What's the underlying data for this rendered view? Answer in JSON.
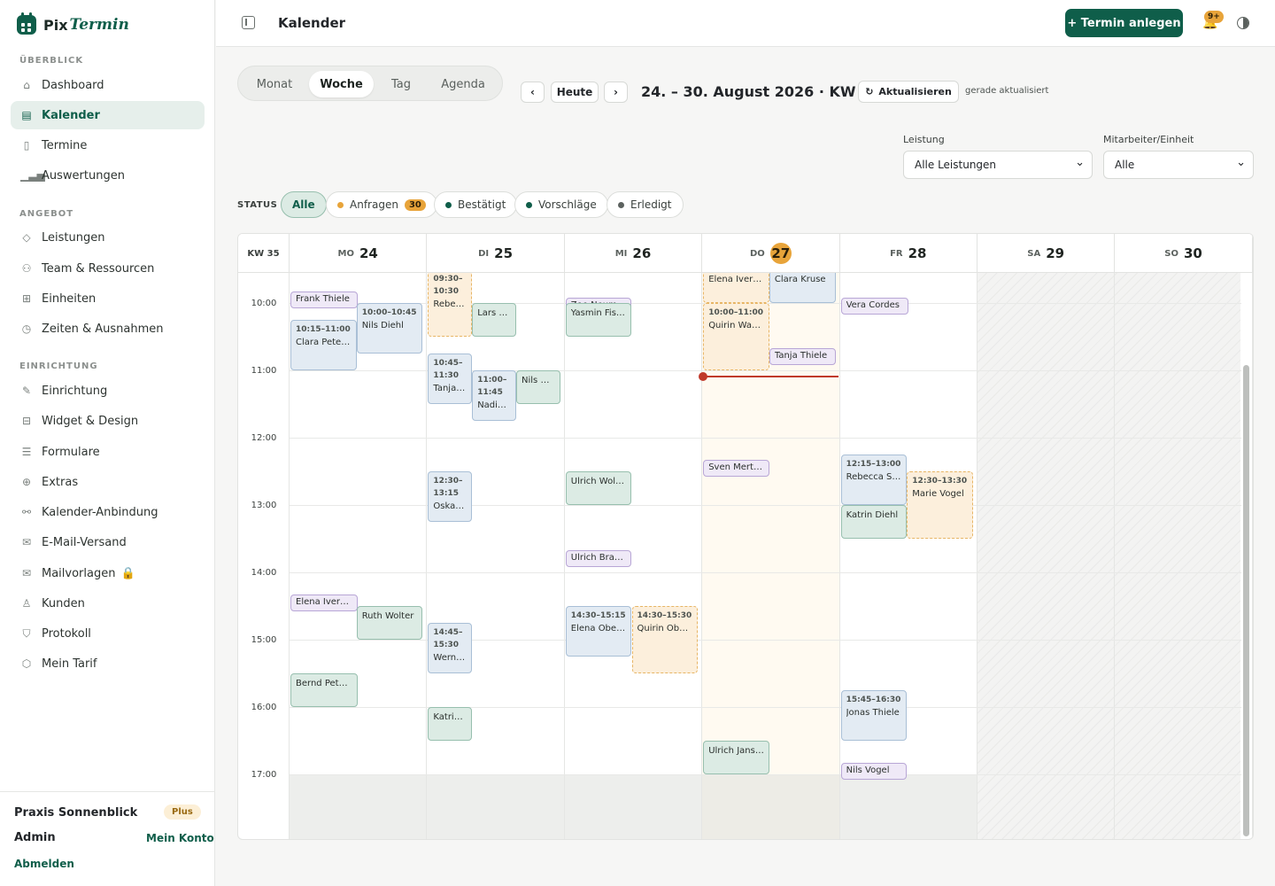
{
  "brand": {
    "name_a": "Pix",
    "name_b": "Termin"
  },
  "sidebar": {
    "sections": [
      "ÜBERBLICK",
      "ANGEBOT",
      "EINRICHTUNG"
    ],
    "items": [
      "Dashboard",
      "Kalender",
      "Termine",
      "Auswertungen",
      "Leistungen",
      "Team & Ressourcen",
      "Einheiten",
      "Zeiten & Ausnahmen",
      "Einrichtung",
      "Widget & Design",
      "Formulare",
      "Extras",
      "Kalender-Anbindung",
      "E-Mail-Versand",
      "Mailvorlagen",
      "Kunden",
      "Protokoll",
      "Mein Tarif"
    ],
    "footer": {
      "practice": "Praxis Sonnenblick",
      "plan": "Plus",
      "role": "Admin",
      "account": "Mein Konto",
      "logout": "Abmelden"
    }
  },
  "topbar": {
    "title": "Kalender",
    "new_button": "+ Termin anlegen",
    "notif_badge": "9+"
  },
  "toolbar": {
    "views": [
      "Monat",
      "Woche",
      "Tag",
      "Agenda"
    ],
    "active_view": "Woche",
    "prev": "‹",
    "today": "Heute",
    "next": "›",
    "range": "24. – 30. August 2026 · KW 35",
    "refresh": "Aktualisieren",
    "refresh_status": "gerade aktualisiert"
  },
  "filters": {
    "service_label": "Leistung",
    "service_value": "Alle Leistungen",
    "staff_label": "Mitarbeiter/Einheit",
    "staff_value": "Alle"
  },
  "status": {
    "label": "STATUS",
    "all": "Alle",
    "requests": "Anfragen",
    "requests_count": "30",
    "confirmed": "Bestätigt",
    "proposals": "Vorschläge",
    "done": "Erledigt",
    "colors": {
      "requests": "#e8a43a",
      "confirmed": "#0f5e4a",
      "proposals": "#0f5e4a",
      "done": "#5c625f"
    }
  },
  "calendar": {
    "kw": "KW 35",
    "days": [
      {
        "n": "MO",
        "d": "24"
      },
      {
        "n": "DI",
        "d": "25"
      },
      {
        "n": "MI",
        "d": "26"
      },
      {
        "n": "DO",
        "d": "27"
      },
      {
        "n": "FR",
        "d": "28"
      },
      {
        "n": "SA",
        "d": "29"
      },
      {
        "n": "SO",
        "d": "30"
      }
    ],
    "today_index": 3,
    "times": [
      "10:00",
      "11:00",
      "12:00",
      "13:00",
      "14:00",
      "15:00",
      "16:00",
      "17:00"
    ],
    "events": [
      {
        "day": 0,
        "col": 0,
        "cols": 1,
        "start": "09:50",
        "end": "10:05",
        "time": "",
        "name": "Frank Thiele",
        "color": "purple"
      },
      {
        "day": 0,
        "col": 0,
        "cols": 2,
        "start": "10:15",
        "end": "11:00",
        "time": "10:15–11:00",
        "name": "Clara Peter…",
        "color": "blue"
      },
      {
        "day": 0,
        "col": 1,
        "cols": 2,
        "start": "10:00",
        "end": "10:45",
        "time": "10:00–10:45",
        "name": "Nils Diehl",
        "color": "blue"
      },
      {
        "day": 0,
        "col": 0,
        "cols": 1,
        "start": "14:20",
        "end": "14:35",
        "time": "",
        "name": "Elena Ivers…",
        "color": "purple"
      },
      {
        "day": 0,
        "col": 1,
        "cols": 2,
        "start": "14:30",
        "end": "15:00",
        "time": "",
        "name": "Ruth Wolter",
        "color": "green"
      },
      {
        "day": 0,
        "col": 0,
        "cols": 1,
        "start": "15:30",
        "end": "16:00",
        "time": "",
        "name": "Bernd Peter…",
        "color": "green"
      },
      {
        "day": 1,
        "col": 0,
        "cols": 3,
        "start": "09:30",
        "end": "10:30",
        "time": "09:30–10:30",
        "name": "Rebec…",
        "color": "orange"
      },
      {
        "day": 1,
        "col": 1,
        "cols": 3,
        "start": "10:00",
        "end": "10:30",
        "time": "",
        "name": "Lars …",
        "color": "green"
      },
      {
        "day": 1,
        "col": 0,
        "cols": 3,
        "start": "10:45",
        "end": "11:30",
        "time": "10:45–11:30",
        "name": "Tanja …",
        "color": "blue"
      },
      {
        "day": 1,
        "col": 1,
        "cols": 3,
        "start": "11:00",
        "end": "11:45",
        "time": "11:00–11:45",
        "name": "Nadin…",
        "color": "blue"
      },
      {
        "day": 1,
        "col": 2,
        "cols": 3,
        "start": "11:00",
        "end": "11:30",
        "time": "",
        "name": "Nils C…",
        "color": "green"
      },
      {
        "day": 1,
        "col": 0,
        "cols": 3,
        "start": "12:30",
        "end": "13:15",
        "time": "12:30–13:15",
        "name": "Oskar …",
        "color": "blue"
      },
      {
        "day": 1,
        "col": 0,
        "cols": 3,
        "start": "14:45",
        "end": "15:30",
        "time": "14:45–15:30",
        "name": "Werne…",
        "color": "blue"
      },
      {
        "day": 1,
        "col": 0,
        "cols": 3,
        "start": "16:00",
        "end": "16:30",
        "time": "",
        "name": "Katrin …",
        "color": "green"
      },
      {
        "day": 2,
        "col": 0,
        "cols": 2,
        "start": "09:55",
        "end": "10:10",
        "time": "",
        "name": "Zoe Neuma…",
        "color": "purple"
      },
      {
        "day": 2,
        "col": 0,
        "cols": 2,
        "start": "10:00",
        "end": "10:30",
        "time": "",
        "name": "Yasmin Fisc…",
        "color": "green"
      },
      {
        "day": 2,
        "col": 0,
        "cols": 2,
        "start": "12:30",
        "end": "13:00",
        "time": "",
        "name": "Ulrich Wolter",
        "color": "green"
      },
      {
        "day": 2,
        "col": 0,
        "cols": 2,
        "start": "13:40",
        "end": "13:55",
        "time": "",
        "name": "Ulrich Brandt",
        "color": "purple"
      },
      {
        "day": 2,
        "col": 0,
        "cols": 2,
        "start": "14:30",
        "end": "15:15",
        "time": "14:30–15:15",
        "name": "Elena Ober…",
        "color": "blue"
      },
      {
        "day": 2,
        "col": 1,
        "cols": 2,
        "start": "14:30",
        "end": "15:30",
        "time": "14:30–15:30",
        "name": "Quirin Ober…",
        "color": "orange"
      },
      {
        "day": 3,
        "col": 0,
        "cols": 2,
        "start": "09:30",
        "end": "10:00",
        "time": "",
        "name": "Elena Ivers…",
        "color": "orange"
      },
      {
        "day": 3,
        "col": 1,
        "cols": 2,
        "start": "09:30",
        "end": "10:00",
        "time": "",
        "name": "Clara Kruse",
        "color": "blue"
      },
      {
        "day": 3,
        "col": 0,
        "cols": 2,
        "start": "10:00",
        "end": "11:00",
        "time": "10:00–11:00",
        "name": "Quirin Wag…",
        "color": "orange"
      },
      {
        "day": 3,
        "col": 1,
        "cols": 2,
        "start": "10:40",
        "end": "10:55",
        "time": "",
        "name": "Tanja Thiele",
        "color": "purple"
      },
      {
        "day": 3,
        "col": 0,
        "cols": 2,
        "start": "12:20",
        "end": "12:35",
        "time": "",
        "name": "Sven Merte…",
        "color": "purple"
      },
      {
        "day": 3,
        "col": 0,
        "cols": 2,
        "start": "16:30",
        "end": "17:00",
        "time": "",
        "name": "Ulrich Jansen",
        "color": "green"
      },
      {
        "day": 4,
        "col": 0,
        "cols": 1,
        "start": "09:55",
        "end": "10:10",
        "time": "",
        "name": "Vera Cordes",
        "color": "purple"
      },
      {
        "day": 4,
        "col": 0,
        "cols": 2,
        "start": "12:15",
        "end": "13:00",
        "time": "12:15–13:00",
        "name": "Rebecca Sa…",
        "color": "blue"
      },
      {
        "day": 4,
        "col": 0,
        "cols": 2,
        "start": "13:00",
        "end": "13:30",
        "time": "",
        "name": "Katrin Diehl",
        "color": "green"
      },
      {
        "day": 4,
        "col": 1,
        "cols": 2,
        "start": "12:30",
        "end": "13:30",
        "time": "12:30–13:30",
        "name": "Marie Vogel",
        "color": "orange"
      },
      {
        "day": 4,
        "col": 0,
        "cols": 2,
        "start": "15:45",
        "end": "16:30",
        "time": "15:45–16:30",
        "name": "Jonas Thiele",
        "color": "blue"
      },
      {
        "day": 4,
        "col": 0,
        "cols": 2,
        "start": "16:50",
        "end": "17:05",
        "time": "",
        "name": "Nils Vogel",
        "color": "purple"
      }
    ]
  }
}
